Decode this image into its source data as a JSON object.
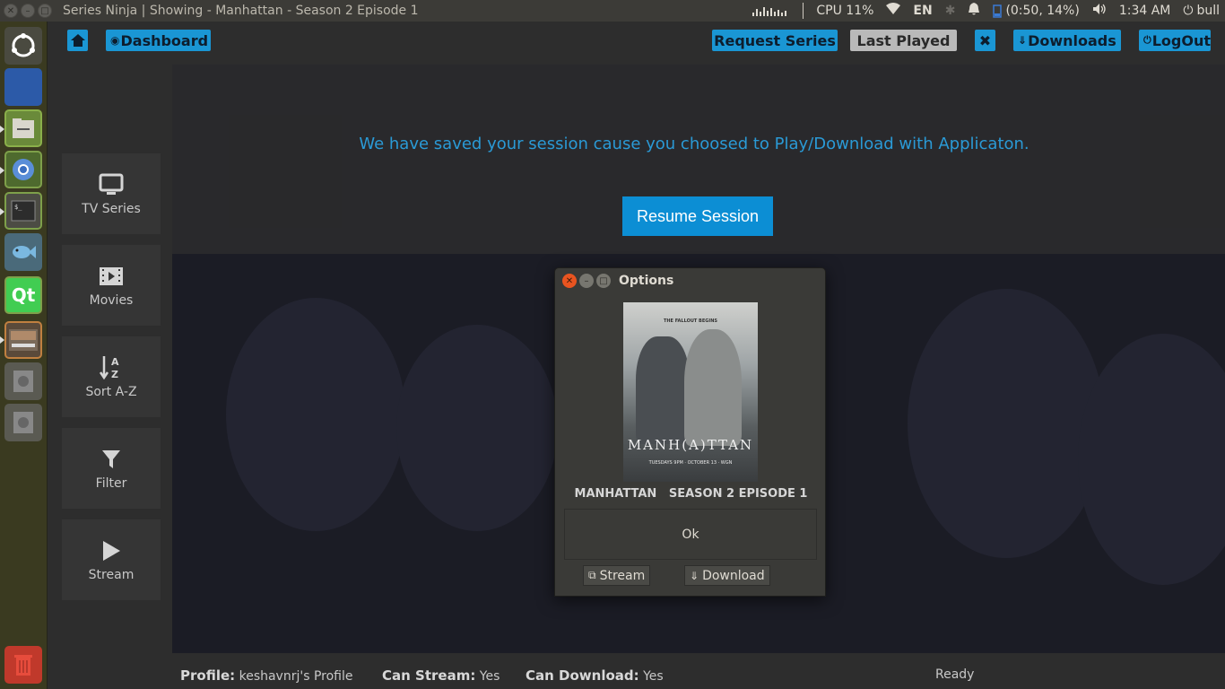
{
  "window": {
    "title": "Series Ninja | Showing - Manhattan - Season 2 Episode 1"
  },
  "tray": {
    "cpu": "CPU 11%",
    "lang": "EN",
    "battery": "(0:50, 14%)",
    "time": "1:34 AM",
    "user": "bull"
  },
  "navbar": {
    "dashboard": "Dashboard",
    "request": "Request Series",
    "last_played": "Last Played",
    "downloads": "Downloads",
    "logout": "LogOut"
  },
  "sidebar": {
    "items": [
      {
        "label": "TV Series",
        "icon": "monitor-icon"
      },
      {
        "label": "Movies",
        "icon": "film-icon"
      },
      {
        "label": "Sort A-Z",
        "icon": "sort-az-icon"
      },
      {
        "label": "Filter",
        "icon": "filter-icon"
      },
      {
        "label": "Stream",
        "icon": "play-icon"
      }
    ]
  },
  "notice": {
    "message": "We have saved your session cause you choosed to Play/Download with Applicaton.",
    "resume": "Resume Session"
  },
  "dialog": {
    "title": "Options",
    "poster": {
      "tagline": "THE FALLOUT BEGINS",
      "title": "MANH(A)TTAN",
      "footer": "TUESDAYS 9PM · OCTOBER 13 · WGN"
    },
    "episode": "MANHATTAN   SEASON 2 EPISODE 1",
    "ok": "Ok",
    "stream": "Stream",
    "download": "Download"
  },
  "status": {
    "profile_label": "Profile:",
    "profile_value": "keshavnrj's Profile",
    "stream_label": "Can Stream:",
    "stream_value": "Yes",
    "download_label": "Can Download:",
    "download_value": "Yes",
    "state": "Ready"
  },
  "colors": {
    "accent": "#1a96d4",
    "notice_text": "#2a9ad6"
  }
}
